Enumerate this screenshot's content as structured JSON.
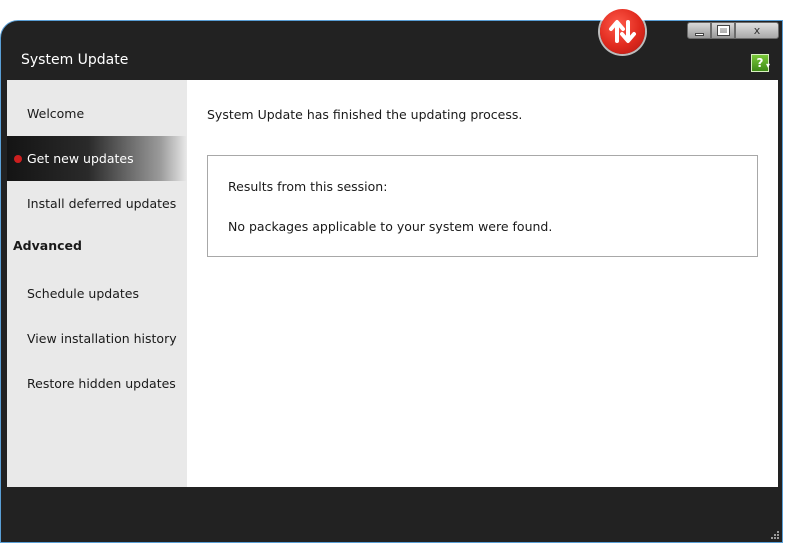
{
  "window": {
    "title": "System Update",
    "controls": {
      "minimize": "",
      "maximize": "",
      "close": "x"
    }
  },
  "header_icons": {
    "help": "?",
    "updater": "update-arrows-icon"
  },
  "sidebar": {
    "items": [
      {
        "label": "Welcome",
        "active": false
      },
      {
        "label": "Get new updates",
        "active": true
      },
      {
        "label": "Install deferred updates",
        "active": false
      }
    ],
    "heading": "Advanced",
    "advanced_items": [
      {
        "label": "Schedule updates"
      },
      {
        "label": "View installation history"
      },
      {
        "label": "Restore hidden updates"
      }
    ]
  },
  "main": {
    "message": "System Update has finished the updating process.",
    "results": {
      "title": "Results from this session:",
      "text": "No packages applicable to your system were found."
    }
  },
  "colors": {
    "frame": "#222222",
    "sidebar": "#e9e9e9",
    "active_dot": "#cc1f1f",
    "help_green": "#5aa82a",
    "updater_red": "#e02a1e"
  }
}
